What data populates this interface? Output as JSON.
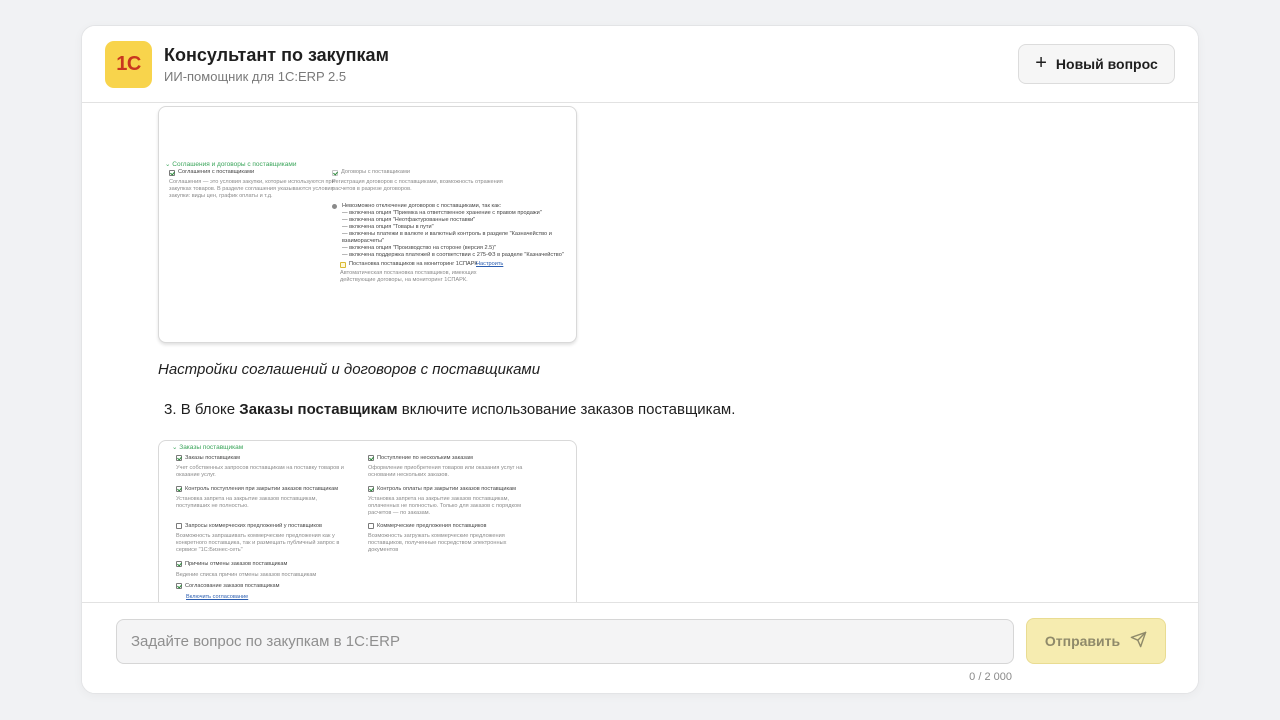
{
  "header": {
    "logo_text": "1С",
    "title": "Консультант по закупкам",
    "subtitle": "ИИ-помощник для 1С:ERP 2.5",
    "new_question_icon": "plus-icon",
    "new_question_label": "Новый вопрос"
  },
  "chat": {
    "caption": "Настройки соглашений и договоров с поставщиками",
    "step_number": "3.",
    "step_prefix": "В блоке",
    "step_bold": "Заказы поставщикам",
    "step_suffix": "включите использование заказов поставщикам."
  },
  "screenshot1": {
    "section_title": "Соглашения и договоры с поставщиками",
    "agreements_checkbox": "Соглашения с поставщиками",
    "agreements_desc_1": "Соглашения — это условия закупки, которые используются при",
    "agreements_desc_2": "закупках товаров. В разделе соглашения указываются условия",
    "agreements_desc_3": "закупки: виды цен, график оплаты и т.д.",
    "contracts_checkbox": "Договоры с поставщиками",
    "contracts_desc_1": "Регистрация договоров с поставщиками, возможность отражения",
    "contracts_desc_2": "расчетов в разрезе договоров.",
    "warning_title": "Невозможно отключение договоров с поставщиками, так как:",
    "warning_lines": [
      "— включена опция \"Приемка на ответственное хранение с правом продажи\"",
      "— включена опция \"Неотфактурованные поставки\"",
      "— включена опция \"Товары в пути\"",
      "— включены платежи в валюте и валютный контроль в разделе \"Казначейство и",
      "взаиморасчеты\"",
      "— включена опция \"Производство на стороне (версия 2.5)\"",
      "— включена поддержка платежей в соответствии с 275-ФЗ в разделе \"Казначейство\""
    ],
    "monitoring_checkbox": "Постановка поставщиков на мониторинг 1СПАРК",
    "monitoring_link": "Настроить",
    "monitoring_desc_1": "Автоматическая постановка поставщиков, имеющих",
    "monitoring_desc_2": "действующие договоры, на мониторинг 1СПАРК."
  },
  "screenshot2": {
    "section_title": "Заказы поставщикам",
    "orders_checkbox": "Заказы поставщикам",
    "orders_desc_1": "Учет собственных запросов поставщикам на поставку товаров и",
    "orders_desc_2": "оказание услуг.",
    "receipt_multi_checkbox": "Поступление по нескольким заказам",
    "receipt_multi_desc_1": "Оформление приобретения товаров или оказания услуг на",
    "receipt_multi_desc_2": "основании нескольких заказов.",
    "control_receipt_checkbox": "Контроль поступления при закрытии заказов поставщикам",
    "control_receipt_desc_1": "Установка запрета на закрытие заказов поставщикам,",
    "control_receipt_desc_2": "поступивших не полностью.",
    "control_payment_checkbox": "Контроль оплаты при закрытии заказов поставщикам",
    "control_payment_desc_1": "Установка запрета на закрытие заказов поставщикам,",
    "control_payment_desc_2": "оплаченных не полностью. Только для заказов с порядком",
    "control_payment_desc_3": "расчетов — по заказам.",
    "rfq_checkbox": "Запросы коммерческих предложений у поставщиков",
    "rfq_desc_1": "Возможность запрашивать коммерческие предложения как у",
    "rfq_desc_2": "конкретного поставщика, так и размещать публичный запрос в",
    "rfq_desc_3": "сервисе \"1С:Бизнес-сеть\"",
    "offers_checkbox": "Коммерческие предложения поставщиков",
    "offers_desc_1": "Возможность загружать коммерческие предложения",
    "offers_desc_2": "поставщиков, полученные посредством электронных",
    "offers_desc_3": "документов",
    "cancel_reasons_checkbox": "Причины отмены заказов поставщикам",
    "cancel_reasons_desc": "Ведение списка причин отмены заказов поставщикам",
    "approval_checkbox": "Согласование заказов поставщикам",
    "approval_link": "Включить согласование"
  },
  "composer": {
    "placeholder": "Задайте вопрос по закупкам в 1С:ERP",
    "value": "",
    "send_label": "Отправить",
    "send_icon": "paper-plane-icon",
    "counter": "0 / 2 000"
  }
}
